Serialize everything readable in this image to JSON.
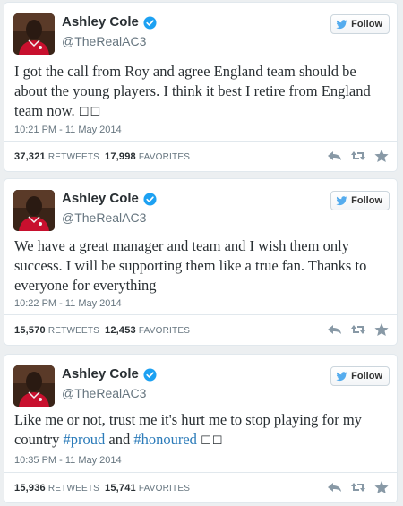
{
  "colors": {
    "hashtag": "#2b7bb9",
    "verified": "#1da1f2",
    "twitter_bird": "#55acee",
    "muted": "#66757f",
    "text": "#292f33"
  },
  "tweets": [
    {
      "name": "Ashley Cole",
      "handle": "@TheRealAC3",
      "follow_label": "Follow",
      "text_parts": [
        {
          "text": "I got the call from Roy and agree England team should be about the young players. I think it best I retire from England team now. "
        },
        {
          "text": "☐☐"
        }
      ],
      "timestamp": "10:21 PM - 11 May 2014",
      "retweets_count": "37,321",
      "retweets_label": "RETWEETS",
      "favorites_count": "17,998",
      "favorites_label": "FAVORITES"
    },
    {
      "name": "Ashley Cole",
      "handle": "@TheRealAC3",
      "follow_label": "Follow",
      "text_parts": [
        {
          "text": "We have a great manager and team and I wish them only success. I will be supporting them like a true fan. Thanks to everyone for everything"
        }
      ],
      "timestamp": "10:22 PM - 11 May 2014",
      "retweets_count": "15,570",
      "retweets_label": "RETWEETS",
      "favorites_count": "12,453",
      "favorites_label": "FAVORITES"
    },
    {
      "name": "Ashley Cole",
      "handle": "@TheRealAC3",
      "follow_label": "Follow",
      "text_parts": [
        {
          "text": "Like me or not, trust me it's hurt me to stop playing for my country "
        },
        {
          "text": "#proud"
        },
        {
          "text": " and "
        },
        {
          "text": "#honoured"
        },
        {
          "text": " "
        },
        {
          "text": "☐☐"
        }
      ],
      "timestamp": "10:35 PM - 11 May 2014",
      "retweets_count": "15,936",
      "retweets_label": "RETWEETS",
      "favorites_count": "15,741",
      "favorites_label": "FAVORITES"
    }
  ]
}
